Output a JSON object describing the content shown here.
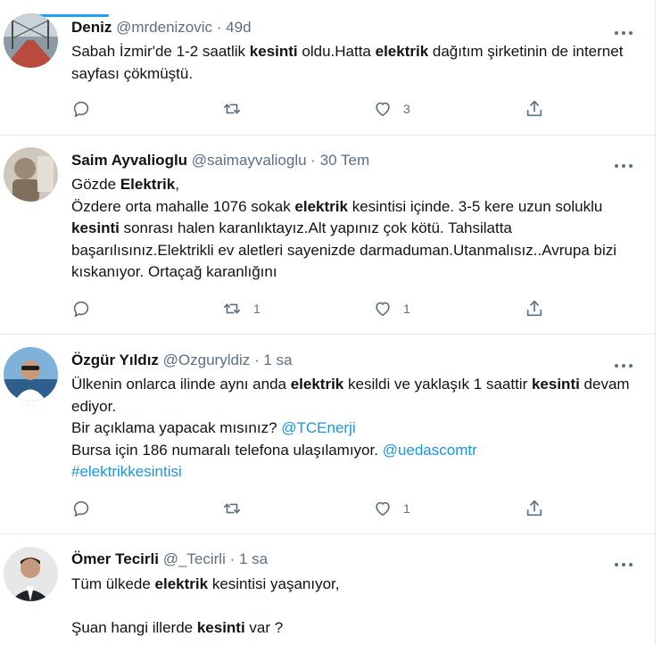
{
  "tweets": [
    {
      "name": "Deniz",
      "handle": "@mrdenizovic",
      "sep": "·",
      "time": "49d",
      "body": [
        [
          {
            "t": "Sabah İzmir'de 1-2 saatlik "
          },
          {
            "t": "kesinti",
            "k": "kw"
          },
          {
            "t": " oldu.Hatta "
          },
          {
            "t": "elektrik",
            "k": "kw"
          },
          {
            "t": " dağıtım şirketinin de internet sayfası çökmüştü."
          }
        ]
      ],
      "counts": {
        "reply": "",
        "retweet": "",
        "like": "3"
      }
    },
    {
      "name": "Saim Ayvalioglu",
      "handle": "@saimayvalioglu",
      "sep": "·",
      "time": "30 Tem",
      "body": [
        [
          {
            "t": "Gözde "
          },
          {
            "t": "Elektrik",
            "k": "kw"
          },
          {
            "t": ","
          }
        ],
        [
          {
            "t": "Özdere orta mahalle 1076 sokak "
          },
          {
            "t": "elektrik",
            "k": "kw"
          },
          {
            "t": " kesintisi içinde. 3-5 kere uzun soluklu "
          },
          {
            "t": "kesinti",
            "k": "kw"
          },
          {
            "t": " sonrası halen karanlıktayız.Alt yapınız çok kötü. Tahsilatta başarılısınız.Elektrikli ev aletleri sayenizde darmaduman.Utanmalısız..Avrupa bizi kıskanıyor. Ortaçağ karanlığını"
          }
        ]
      ],
      "counts": {
        "reply": "",
        "retweet": "1",
        "like": "1"
      }
    },
    {
      "name": "Özgür Yıldız",
      "handle": "@Ozguryldiz",
      "sep": "·",
      "time": "1 sa",
      "body": [
        [
          {
            "t": "Ülkenin onlarca ilinde aynı anda "
          },
          {
            "t": "elektrik",
            "k": "kw"
          },
          {
            "t": " kesildi ve yaklaşık 1 saattir "
          },
          {
            "t": "kesinti",
            "k": "kw"
          },
          {
            "t": " devam ediyor."
          }
        ],
        [
          {
            "t": "Bir açıklama yapacak mısınız? "
          },
          {
            "t": "@TCEnerji",
            "k": "link"
          }
        ],
        [
          {
            "t": "Bursa için 186 numaralı telefona ulaşılamıyor. "
          },
          {
            "t": "@uedascomtr",
            "k": "link"
          }
        ],
        [
          {
            "t": "#elektrikkesintisi",
            "k": "link"
          }
        ]
      ],
      "counts": {
        "reply": "",
        "retweet": "",
        "like": "1"
      }
    },
    {
      "name": "Ömer Tecirli",
      "handle": "@_Tecirli",
      "sep": "·",
      "time": "1 sa",
      "body": [
        [
          {
            "t": "Tüm ülkede "
          },
          {
            "t": "elektrik",
            "k": "kw"
          },
          {
            "t": " kesintisi yaşanıyor,"
          }
        ],
        [
          {
            "t": " "
          }
        ],
        [
          {
            "t": "Şuan hangi illerde "
          },
          {
            "t": "kesinti",
            "k": "kw"
          },
          {
            "t": " var ?"
          }
        ]
      ],
      "counts": {
        "reply": "",
        "retweet": "",
        "like": ""
      }
    }
  ],
  "colors": {
    "keyword": "#0f1419",
    "link": "#1b95e0",
    "meta": "#5b7083",
    "accent": "#1da1f2",
    "divider": "#e6ecf0"
  },
  "icons": {
    "reply": "reply-icon",
    "retweet": "retweet-icon",
    "like": "like-icon",
    "share": "share-icon",
    "more": "more-icon"
  }
}
